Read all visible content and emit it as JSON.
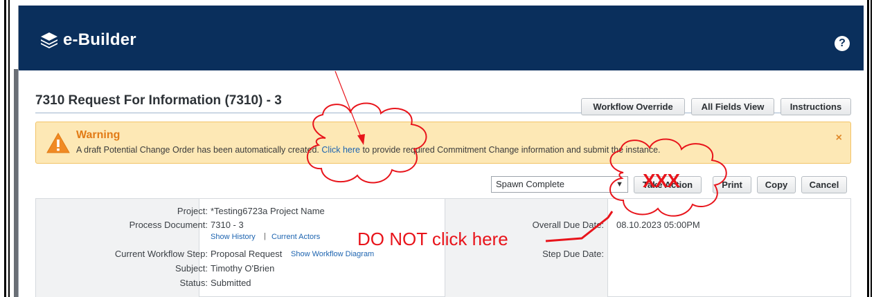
{
  "app": {
    "logo_text": "e-Builder",
    "help_glyph": "?"
  },
  "page": {
    "title": "7310 Request For Information (7310) - 3"
  },
  "header_buttons": {
    "workflow_override": "Workflow Override",
    "all_fields_view": "All Fields View",
    "instructions": "Instructions"
  },
  "warning": {
    "title": "Warning",
    "message_prefix": "A draft Potential Change Order has been automatically created. ",
    "link_text": "Click here",
    "message_suffix": " to provide required Commitment Change information and submit the instance.",
    "close_glyph": "×"
  },
  "action_bar": {
    "select_value": "Spawn Complete",
    "take_action": "Take Action",
    "print": "Print",
    "copy": "Copy",
    "cancel": "Cancel"
  },
  "details": {
    "project_label": "Project:",
    "project_value": "*Testing6723a Project Name",
    "process_document_label": "Process Document:",
    "process_document_value": "7310 - 3",
    "show_history": "Show History",
    "link_separator": "|",
    "current_actors": "Current Actors",
    "current_step_label": "Current Workflow Step:",
    "current_step_value": "Proposal Request",
    "show_workflow_diagram": "Show Workflow Diagram",
    "subject_label": "Subject:",
    "subject_value": "Timothy O'Brien",
    "status_label": "Status:",
    "status_value": "Submitted",
    "overall_due_label": "Overall Due Date:",
    "overall_due_value": "08.10.2023 05:00PM",
    "step_due_label": "Step Due Date:",
    "step_due_value": ""
  },
  "annotations": {
    "do_not_click": "DO NOT click here",
    "xxx": "XXX"
  },
  "colors": {
    "topbar": "#0a2f5c",
    "warning_bg": "#fde8b5",
    "warning_title": "#e27b16",
    "link": "#1d64b0",
    "annotation_red": "#e8141b"
  }
}
